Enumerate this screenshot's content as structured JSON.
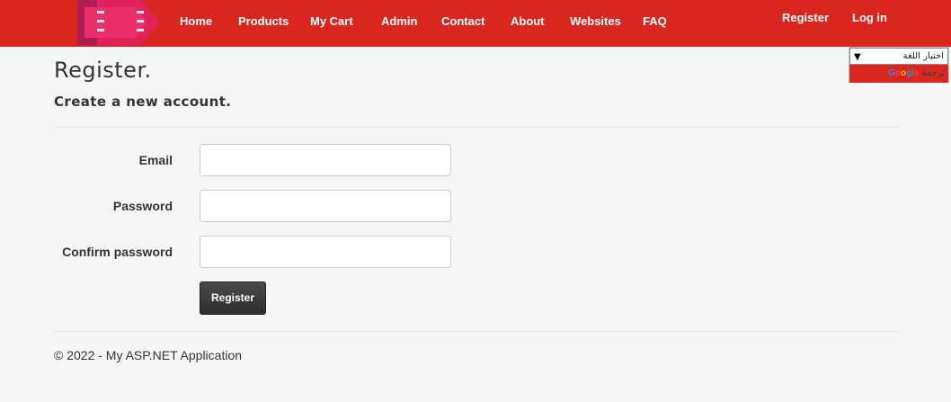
{
  "nav": {
    "links": [
      "Home",
      "Products",
      "My Cart",
      "Admin",
      "Contact",
      "About",
      "Websites",
      "FAQ"
    ],
    "register": "Register",
    "login": "Log in"
  },
  "translate": {
    "select_value": "اختيار اللغة",
    "powered_prefix": "‏‏",
    "google": "Google",
    "translate_word": "ترجمة"
  },
  "form": {
    "title": "Register.",
    "subtitle": "Create a new account.",
    "email_label": "Email",
    "password_label": "Password",
    "confirm_label": "Confirm password",
    "submit_label": "Register"
  },
  "footer": {
    "text": "© 2022 - My ASP.NET Application"
  },
  "colors": {
    "navbar": "#d9261f",
    "button": "#3a3a3a"
  }
}
